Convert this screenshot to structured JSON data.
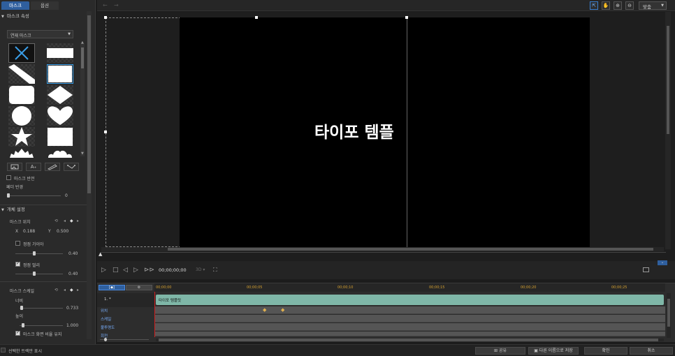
{
  "left_panel": {
    "tabs": [
      "마스크",
      "옵션"
    ],
    "mask_props_header": "마스크 속성",
    "dropdown_value": "연재 마스크",
    "invert_label": "마스크 반전",
    "feather_label": "페더 반경",
    "feather_value": "0",
    "object_settings_header": "개체 설정",
    "mask_position_label": "마스크 위치",
    "x_label": "X",
    "x_value": "0.188",
    "y_label": "Y",
    "y_value": "0.500",
    "snap_label": "정점 가이아",
    "snap_value": "0.40",
    "vertex_dist_label": "정점 멀리",
    "vertex_dist_value": "0.40",
    "mask_scale_label": "마스크 스케일",
    "width_label": "너비",
    "width_value": "0.733",
    "height_label": "높이",
    "height_value": "1.000",
    "keep_ratio_label": "마스크 화면 비율 유지"
  },
  "toolbar": {
    "zoom_select": "맞춤"
  },
  "preview": {
    "title_text": "타이포 템플"
  },
  "controls": {
    "timecode": "00;00;00;00",
    "res": "3D ▾"
  },
  "timeline": {
    "timecodes": [
      "00;00;00",
      "00;00;05",
      "00;00;10",
      "00;00;15",
      "00;00;20",
      "00;00;25"
    ],
    "clip_track_label": "1. *",
    "clip_label": "타이포 템플릿",
    "tracks": [
      "위치",
      "스케일",
      "불투명도",
      "회전"
    ]
  },
  "bottom": {
    "show_selected_label": "선택한 트랙만 표시",
    "share_label": "공유",
    "save_as_label": "다른 이름으로 저장",
    "ok_label": "확인",
    "cancel_label": "취소"
  },
  "colors": {
    "accent": "#2f5f9e",
    "clip": "#7fb7a8",
    "keyframe": "#e0b050",
    "panel": "#2a2a2a"
  },
  "icons": [
    "search-icon",
    "hand-icon",
    "zoom-in-icon",
    "zoom-out-icon",
    "play-icon",
    "stop-icon",
    "keyframe-icon"
  ]
}
